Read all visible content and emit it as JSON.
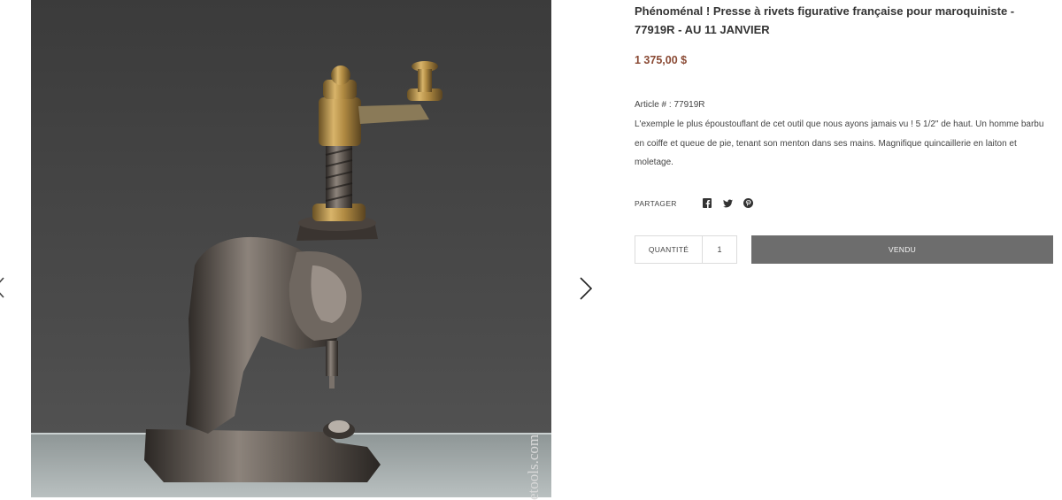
{
  "product": {
    "title": "Phénoménal ! Presse à rivets figurative française pour maroquiniste - 77919R - AU 11 JANVIER",
    "price": "1 375,00 $",
    "sku_line": "Article # : 77919R",
    "description": "L'exemple le plus époustouflant de cet outil que nous ayons jamais vu ! 5 1/2\" de haut. Un homme barbu en coiffe et queue de pie, tenant son menton dans ses mains. Magnifique quincaillerie en laiton et moletage."
  },
  "gallery": {
    "watermark": "etools.com",
    "prev_icon": "chevron-left-icon",
    "next_icon": "chevron-right-icon"
  },
  "share": {
    "label": "PARTAGER",
    "icons": [
      "facebook-icon",
      "twitter-icon",
      "pinterest-icon"
    ]
  },
  "purchase": {
    "quantity_label": "QUANTITÉ",
    "quantity_value": "1",
    "button_label": "VENDU"
  },
  "colors": {
    "price": "#8a4a34",
    "sold_button": "#6d6d6d",
    "photo_background": "#474747"
  }
}
